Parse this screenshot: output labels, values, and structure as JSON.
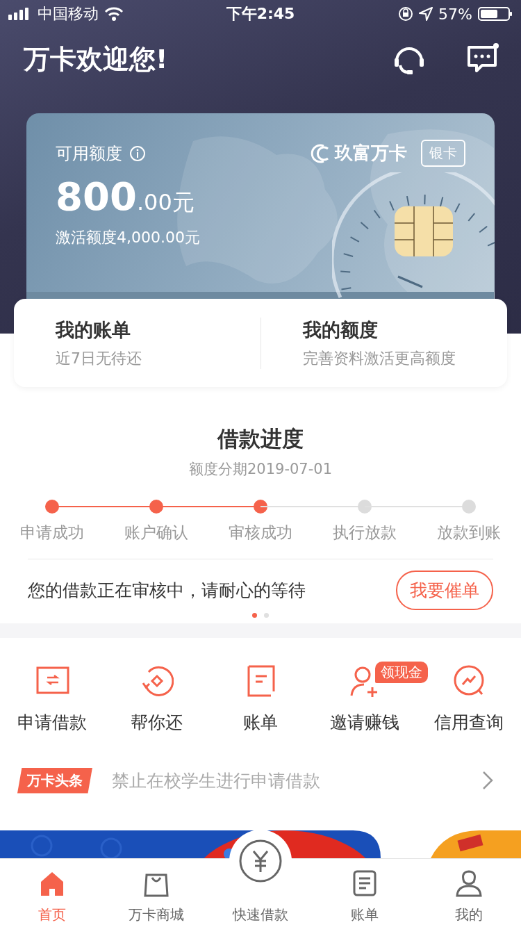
{
  "status_bar": {
    "carrier": "中国移动",
    "time": "下午2:45",
    "battery": "57%"
  },
  "header": {
    "title": "万卡欢迎您!",
    "unread": true
  },
  "card": {
    "label": "可用额度",
    "amount": "800",
    "amount_decimals": ".00元",
    "activation": "激活额度4,000.00元",
    "brand": "玖富万卡",
    "tier": "银卡"
  },
  "summary": [
    {
      "title": "我的账单",
      "subtitle": "近7日无待还"
    },
    {
      "title": "我的额度",
      "subtitle": "完善资料激活更高额度"
    }
  ],
  "loan_progress": {
    "title": "借款进度",
    "subtitle": "额度分期2019-07-01",
    "steps": [
      {
        "label": "申请成功",
        "done": true
      },
      {
        "label": "账户确认",
        "done": true
      },
      {
        "label": "审核成功",
        "done": true
      },
      {
        "label": "执行放款",
        "done": false
      },
      {
        "label": "放款到账",
        "done": false
      }
    ],
    "message": "您的借款正在审核中，请耐心的等待",
    "action": "我要催单",
    "pages": [
      {
        "selected": true
      },
      {
        "selected": false
      }
    ]
  },
  "shortcuts": [
    {
      "label": "申请借款"
    },
    {
      "label": "帮你还"
    },
    {
      "label": "账单"
    },
    {
      "label": "邀请赚钱",
      "badge": "领现金"
    },
    {
      "label": "信用查询"
    }
  ],
  "news": {
    "tag": "万卡头条",
    "text": "禁止在校学生进行申请借款"
  },
  "tab_bar": [
    {
      "label": "首页",
      "selected": true
    },
    {
      "label": "万卡商城",
      "selected": false
    },
    {
      "label": "快速借款",
      "selected": false
    },
    {
      "label": "账单",
      "selected": false
    },
    {
      "label": "我的",
      "selected": false
    }
  ]
}
